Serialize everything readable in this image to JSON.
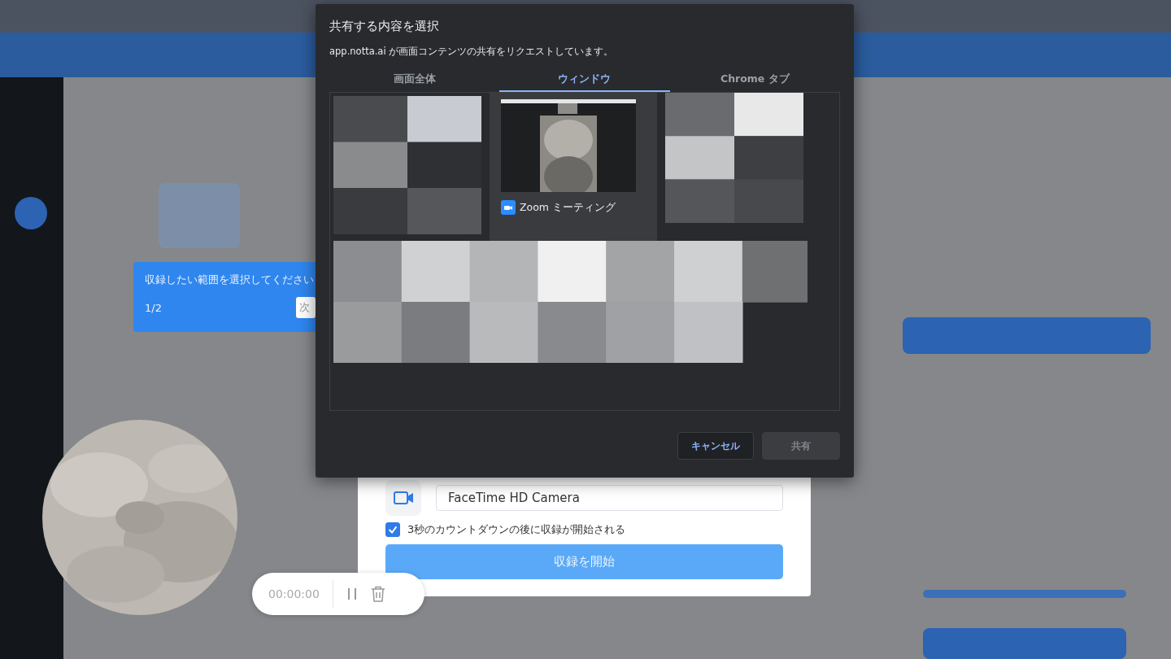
{
  "dialog": {
    "title": "共有する内容を選択",
    "message": "app.notta.ai が画面コンテンツの共有をリクエストしています。",
    "tabs": [
      {
        "label": "画面全体",
        "selected": false
      },
      {
        "label": "ウィンドウ",
        "selected": true
      },
      {
        "label": "Chrome タブ",
        "selected": false
      }
    ],
    "windows": [
      {
        "label": "Zoom ミーティング",
        "selected": true
      }
    ],
    "buttons": [
      {
        "label": "キャンセル",
        "disabled": false
      },
      {
        "label": "共有",
        "disabled": true
      }
    ]
  },
  "tour_tooltip": {
    "text": "収録したい範囲を選択してください",
    "step": "1/2",
    "next": "次"
  },
  "recording_panel": {
    "camera": "FaceTime HD Camera",
    "countdown": {
      "label": "3秒のカウントダウンの後に収録が開始される",
      "checked": true
    },
    "start_button": "収録を開始"
  },
  "recorder": {
    "time": "00:00:00"
  }
}
